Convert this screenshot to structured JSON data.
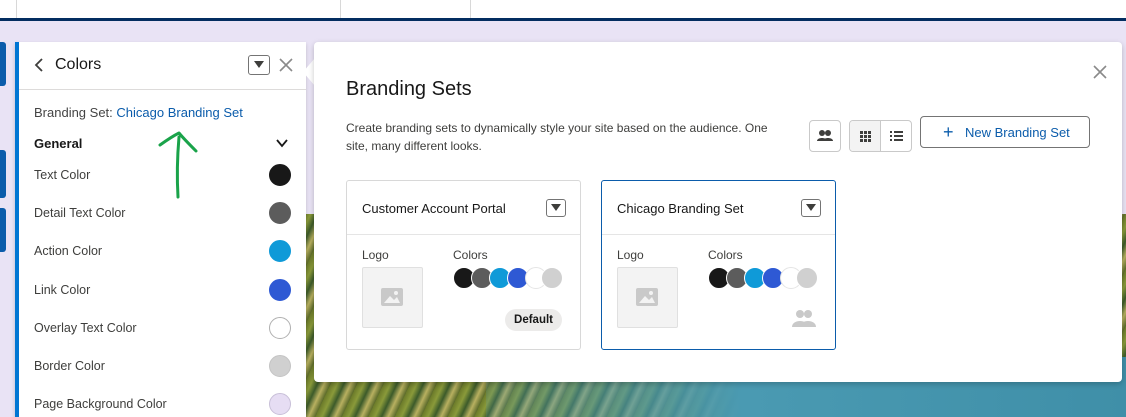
{
  "colors_panel": {
    "title": "Colors",
    "branding_set_label": "Branding Set:",
    "branding_set_name": "Chicago Branding Set",
    "section": "General",
    "colors": [
      {
        "label": "Text Color",
        "hex": "#181818"
      },
      {
        "label": "Detail Text Color",
        "hex": "#5c5c5c"
      },
      {
        "label": "Action Color",
        "hex": "#0f9ad8"
      },
      {
        "label": "Link Color",
        "hex": "#2e59d4"
      },
      {
        "label": "Overlay Text Color",
        "hex": "#ffffff"
      },
      {
        "label": "Border Color",
        "hex": "#d0d0d0"
      },
      {
        "label": "Page Background Color",
        "hex": "#e6ddf3"
      }
    ]
  },
  "dialog": {
    "title": "Branding Sets",
    "description": "Create branding sets to dynamically style your site based on the audience. One site, many different looks.",
    "new_button": "New Branding Set",
    "icons": {
      "audience": "audience-icon",
      "grid": "grid-view-icon",
      "list": "list-view-icon",
      "close": "close-icon"
    }
  },
  "cards": [
    {
      "title": "Customer Account Portal",
      "logo_label": "Logo",
      "colors_label": "Colors",
      "badge": "Default",
      "swatches": [
        "#181818",
        "#5c5c5c",
        "#0f9ad8",
        "#2e59d4",
        "#ffffff",
        "#d0d0d0"
      ]
    },
    {
      "title": "Chicago Branding Set",
      "logo_label": "Logo",
      "colors_label": "Colors",
      "swatches": [
        "#181818",
        "#5c5c5c",
        "#0f9ad8",
        "#2e59d4",
        "#ffffff",
        "#d0d0d0"
      ]
    }
  ],
  "accent_color": "#0176d3",
  "annotation_color": "#1aa34a"
}
